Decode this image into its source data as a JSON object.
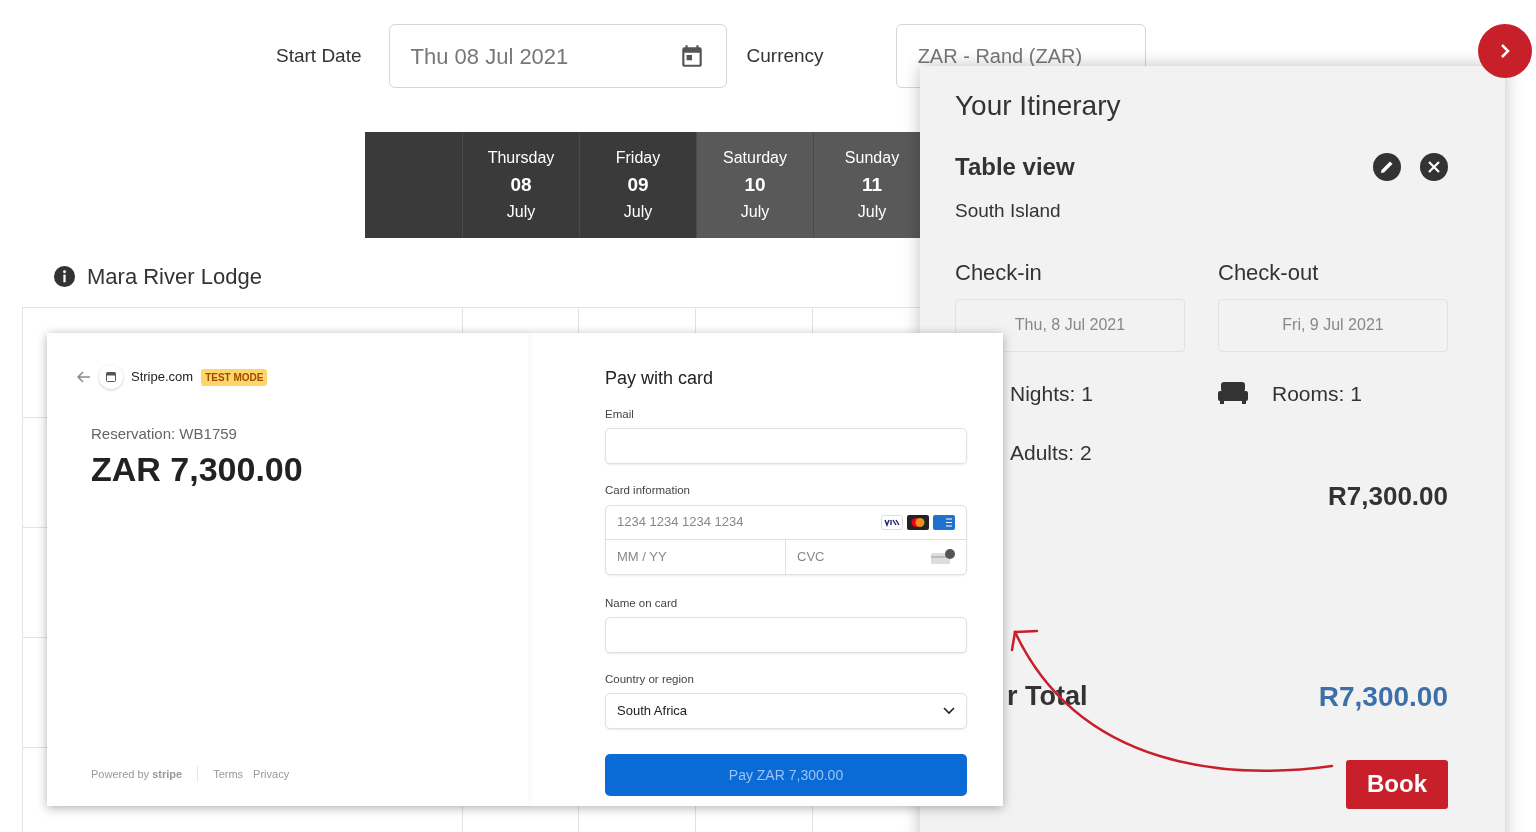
{
  "search_bar": {
    "start_date_label": "Start Date",
    "start_date_value": "Thu 08 Jul 2021",
    "currency_label": "Currency",
    "currency_value": "ZAR - Rand (ZAR)"
  },
  "calendar_header": {
    "days": [
      {
        "weekday": "Thursday",
        "day": "08",
        "month": "July",
        "weekend": false
      },
      {
        "weekday": "Friday",
        "day": "09",
        "month": "July",
        "weekend": false
      },
      {
        "weekday": "Saturday",
        "day": "10",
        "month": "July",
        "weekend": true
      },
      {
        "weekday": "Sunday",
        "day": "11",
        "month": "July",
        "weekend": true
      }
    ]
  },
  "property": {
    "name": "Mara River Lodge"
  },
  "itinerary": {
    "title": "Your Itinerary",
    "view_title": "Table view",
    "region": "South Island",
    "check_in_label": "Check-in",
    "check_in_value": "Thu, 8 Jul 2021",
    "check_out_label": "Check-out",
    "check_out_value": "Fri, 9 Jul 2021",
    "nights": "Nights: 1",
    "rooms": "Rooms: 1",
    "adults": "Adults: 2",
    "subtotal": "R7,300.00",
    "total_label": "r Total",
    "total_value": "R7,300.00",
    "book_button": "Book"
  },
  "checkout": {
    "site": "Stripe.com",
    "mode_badge": "TEST MODE",
    "reservation": "Reservation: WB1759",
    "amount": "ZAR 7,300.00",
    "powered_by": "Powered by **stripe**",
    "links": [
      "Terms",
      "Privacy"
    ],
    "form_title": "Pay with card",
    "email_label": "Email",
    "card_label": "Card information",
    "card_number_placeholder": "1234 1234 1234 1234",
    "expiry_placeholder": "MM / YY",
    "cvc_placeholder": "CVC",
    "name_label": "Name on card",
    "country_label": "Country or region",
    "country_value": "South Africa",
    "pay_button": "Pay ZAR 7,300.00"
  }
}
